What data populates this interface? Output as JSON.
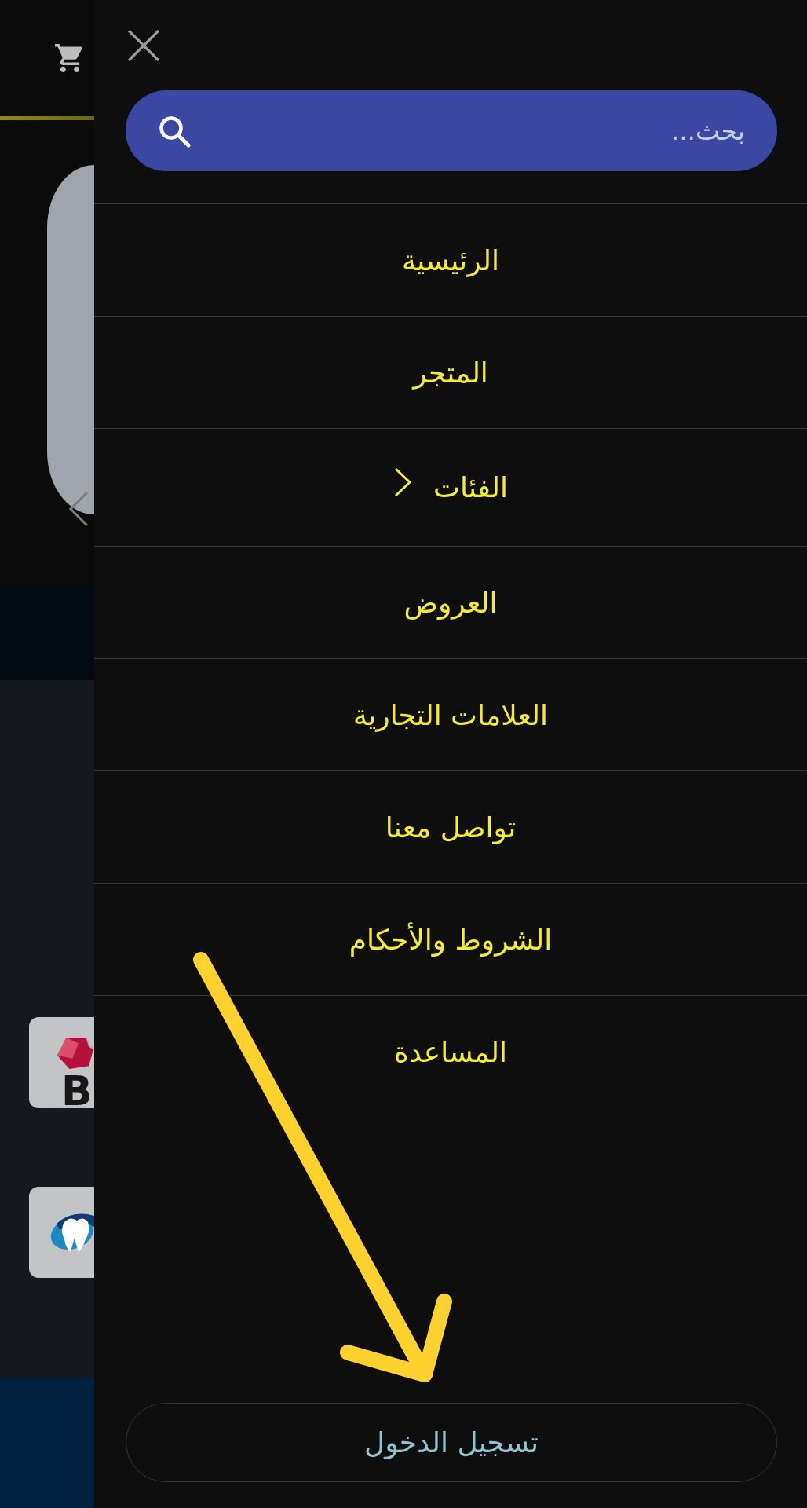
{
  "background_page": {
    "brand_tiles": [
      {
        "kind": "letter-logo",
        "letter": "B"
      },
      {
        "kind": "tooth-logo"
      }
    ]
  },
  "drawer": {
    "search": {
      "placeholder": "بحث..."
    },
    "menu": [
      {
        "label": "الرئيسية",
        "kind": "link"
      },
      {
        "label": "المتجر",
        "kind": "link"
      },
      {
        "label": "الفئات",
        "kind": "submenu"
      },
      {
        "label": "العروض",
        "kind": "link"
      },
      {
        "label": "العلامات التجارية",
        "kind": "link"
      },
      {
        "label": "تواصل معنا",
        "kind": "link"
      },
      {
        "label": "الشروط والأحكام",
        "kind": "link"
      },
      {
        "label": "المساعدة",
        "kind": "link"
      }
    ],
    "login_button": "تسجيل الدخول"
  }
}
